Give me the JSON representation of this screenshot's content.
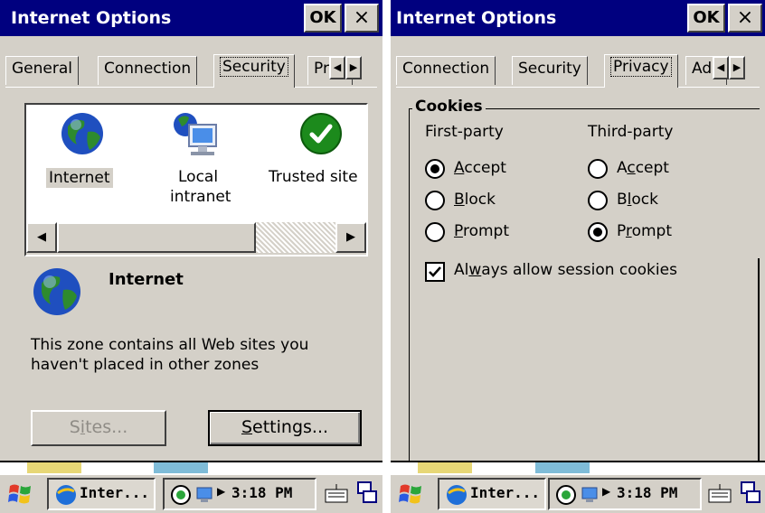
{
  "left": {
    "title": "Internet Options",
    "ok_label": "OK",
    "close_label": "×",
    "tabs": [
      "General",
      "Connection",
      "Security",
      "Pri"
    ],
    "zones": [
      {
        "label": "Internet"
      },
      {
        "label_line1": "Local",
        "label_line2": "intranet"
      },
      {
        "label": "Trusted site"
      }
    ],
    "selected_zone_title": "Internet",
    "zone_description_line1": "This zone contains all Web sites you",
    "zone_description_line2": "haven't placed in other zones",
    "sites_pre": "S",
    "sites_ul": "i",
    "sites_post": "tes...",
    "settings_ul": "S",
    "settings_post": "ettings..."
  },
  "right": {
    "title": "Internet Options",
    "ok_label": "OK",
    "close_label": "×",
    "tabs": [
      "Connection",
      "Security",
      "Privacy",
      "Ad"
    ],
    "group_title": "Cookies",
    "first_party": "First-party",
    "third_party": "Third-party",
    "fp": {
      "accept_ul": "A",
      "accept_post": "ccept",
      "block_ul": "B",
      "block_post": "lock",
      "prompt_ul": "P",
      "prompt_post": "rompt",
      "selected": "accept"
    },
    "tp": {
      "accept_pre": "A",
      "accept_ul": "c",
      "accept_post": "cept",
      "block_pre": "B",
      "block_ul": "l",
      "block_post": "ock",
      "prompt_pre": "P",
      "prompt_ul": "r",
      "prompt_post": "ompt",
      "selected": "prompt"
    },
    "session_pre": "Al",
    "session_ul": "w",
    "session_post": "ays allow session cookies",
    "session_checked": true
  },
  "taskbar": {
    "left_task_label": "Inter...",
    "left_time": "3:18 PM",
    "right_task_label": "Inter...",
    "right_time": "3:18 PM"
  },
  "colors": {
    "titlebar": "#00007f",
    "face": "#d4d0c8",
    "highlight": "#ffffff",
    "shadow": "#404040",
    "globe_blue": "#1f4fbf",
    "globe_green": "#2e8b2e",
    "trusted_green": "#1c8a1c"
  },
  "icons": [
    "windows-flag-icon",
    "ie-icon",
    "network-icon",
    "sync-icon",
    "keyboard-icon",
    "multi-window-icon"
  ]
}
